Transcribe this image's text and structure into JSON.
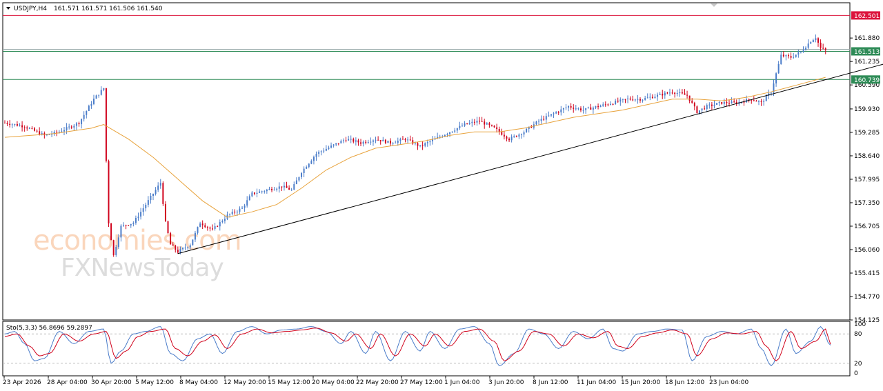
{
  "header": {
    "symbol": "USDJPY,H4",
    "ohlc": "161.571 161.571 161.506 161.540"
  },
  "watermark": {
    "line1": "economies.com",
    "line2": "FXNewsToday"
  },
  "chart_data": [
    {
      "type": "candlestick",
      "series_name": "USDJPY,H4",
      "ylim": [
        154.125,
        162.85
      ],
      "y_ticks": [
        "162.501",
        "161.880",
        "161.513",
        "161.235",
        "160.739",
        "160.590",
        "159.930",
        "159.285",
        "158.640",
        "157.995",
        "157.350",
        "156.705",
        "156.060",
        "155.415",
        "154.770",
        "154.125"
      ],
      "x_ticks": [
        "23 Apr 2026",
        "28 Apr 04:00",
        "30 Apr 20:00",
        "5 May 12:00",
        "8 May 04:00",
        "12 May 20:00",
        "15 May 12:00",
        "20 May 04:00",
        "22 May 20:00",
        "27 May 12:00",
        "1 Jun 04:00",
        "3 Jun 20:00",
        "8 Jun 12:00",
        "11 Jun 04:00",
        "15 Jun 20:00",
        "18 Jun 12:00",
        "23 Jun 04:00"
      ],
      "close_path": [
        [
          0,
          159.55
        ],
        [
          8,
          159.45
        ],
        [
          16,
          159.2
        ],
        [
          22,
          159.3
        ],
        [
          30,
          159.55
        ],
        [
          36,
          160.2
        ],
        [
          40,
          160.5
        ],
        [
          41,
          158.5
        ],
        [
          42,
          156.8
        ],
        [
          44,
          155.9
        ],
        [
          47,
          156.7
        ],
        [
          52,
          156.8
        ],
        [
          57,
          157.3
        ],
        [
          61,
          157.7
        ],
        [
          63,
          157.9
        ],
        [
          65,
          156.8
        ],
        [
          67,
          156.2
        ],
        [
          70,
          156.0
        ],
        [
          75,
          156.2
        ],
        [
          79,
          156.8
        ],
        [
          84,
          156.6
        ],
        [
          90,
          157.0
        ],
        [
          96,
          157.2
        ],
        [
          100,
          157.6
        ],
        [
          106,
          157.7
        ],
        [
          112,
          157.8
        ],
        [
          116,
          157.7
        ],
        [
          120,
          158.2
        ],
        [
          126,
          158.7
        ],
        [
          132,
          158.9
        ],
        [
          138,
          159.1
        ],
        [
          144,
          159.0
        ],
        [
          150,
          159.1
        ],
        [
          156,
          159.0
        ],
        [
          162,
          159.1
        ],
        [
          168,
          158.9
        ],
        [
          174,
          159.1
        ],
        [
          180,
          159.3
        ],
        [
          186,
          159.5
        ],
        [
          192,
          159.6
        ],
        [
          198,
          159.4
        ],
        [
          204,
          159.1
        ],
        [
          210,
          159.3
        ],
        [
          216,
          159.6
        ],
        [
          222,
          159.8
        ],
        [
          228,
          160.0
        ],
        [
          234,
          159.9
        ],
        [
          240,
          160.0
        ],
        [
          246,
          160.1
        ],
        [
          252,
          160.2
        ],
        [
          258,
          160.2
        ],
        [
          264,
          160.3
        ],
        [
          270,
          160.4
        ],
        [
          276,
          160.3
        ],
        [
          280,
          159.85
        ],
        [
          284,
          160.0
        ],
        [
          290,
          160.1
        ],
        [
          296,
          160.1
        ],
        [
          302,
          160.2
        ],
        [
          306,
          160.1
        ],
        [
          310,
          160.4
        ],
        [
          312,
          160.9
        ],
        [
          314,
          161.4
        ],
        [
          318,
          161.35
        ],
        [
          322,
          161.5
        ],
        [
          326,
          161.8
        ],
        [
          328,
          161.9
        ],
        [
          330,
          161.6
        ],
        [
          332,
          161.54
        ]
      ],
      "ma_path": [
        [
          0,
          159.15
        ],
        [
          20,
          159.25
        ],
        [
          35,
          159.4
        ],
        [
          40,
          159.5
        ],
        [
          50,
          159.1
        ],
        [
          60,
          158.6
        ],
        [
          70,
          158.0
        ],
        [
          80,
          157.4
        ],
        [
          90,
          156.95
        ],
        [
          100,
          157.1
        ],
        [
          110,
          157.3
        ],
        [
          120,
          157.75
        ],
        [
          130,
          158.25
        ],
        [
          140,
          158.6
        ],
        [
          150,
          158.85
        ],
        [
          160,
          158.95
        ],
        [
          170,
          159.05
        ],
        [
          180,
          159.2
        ],
        [
          190,
          159.3
        ],
        [
          200,
          159.3
        ],
        [
          210,
          159.4
        ],
        [
          220,
          159.55
        ],
        [
          230,
          159.7
        ],
        [
          240,
          159.8
        ],
        [
          250,
          159.9
        ],
        [
          260,
          160.05
        ],
        [
          270,
          160.2
        ],
        [
          280,
          160.2
        ],
        [
          290,
          160.15
        ],
        [
          300,
          160.25
        ],
        [
          310,
          160.4
        ],
        [
          320,
          160.58
        ],
        [
          332,
          160.8
        ]
      ],
      "candles_per_period": 341,
      "trendline": [
        [
          70,
          155.95
        ],
        [
          363,
          161.3
        ]
      ],
      "levels": [
        {
          "value": 162.501,
          "label": "162.501",
          "color": "#dc143c"
        },
        {
          "value": 161.513,
          "label": "161.513",
          "color": "#2e8b57"
        },
        {
          "value": 160.739,
          "label": "160.739",
          "color": "#2e8b57"
        }
      ],
      "colors": {
        "up": "#4a7cc9",
        "down": "#d0021b",
        "ma": "#e8a33d",
        "trendline": "#000000"
      }
    },
    {
      "type": "line",
      "title": "Sto(5,3,3) 56.8696 59.2897",
      "ylim": [
        0,
        100
      ],
      "y_ticks": [
        "100",
        "80",
        "20",
        "0"
      ],
      "levels": [
        80,
        20
      ],
      "series": [
        {
          "name": "main",
          "color": "#4a7cc9"
        },
        {
          "name": "signal",
          "color": "#d0021b"
        }
      ],
      "main_path": [
        [
          0,
          80
        ],
        [
          4,
          85
        ],
        [
          8,
          60
        ],
        [
          12,
          25
        ],
        [
          16,
          30
        ],
        [
          22,
          85
        ],
        [
          28,
          60
        ],
        [
          34,
          85
        ],
        [
          40,
          90
        ],
        [
          43,
          20
        ],
        [
          47,
          45
        ],
        [
          52,
          80
        ],
        [
          57,
          85
        ],
        [
          63,
          95
        ],
        [
          67,
          40
        ],
        [
          72,
          25
        ],
        [
          78,
          70
        ],
        [
          83,
          80
        ],
        [
          88,
          40
        ],
        [
          94,
          85
        ],
        [
          100,
          95
        ],
        [
          106,
          80
        ],
        [
          112,
          88
        ],
        [
          118,
          90
        ],
        [
          124,
          95
        ],
        [
          130,
          85
        ],
        [
          136,
          60
        ],
        [
          140,
          85
        ],
        [
          146,
          40
        ],
        [
          150,
          85
        ],
        [
          156,
          25
        ],
        [
          162,
          85
        ],
        [
          168,
          45
        ],
        [
          172,
          85
        ],
        [
          178,
          50
        ],
        [
          184,
          90
        ],
        [
          190,
          95
        ],
        [
          196,
          60
        ],
        [
          200,
          15
        ],
        [
          206,
          40
        ],
        [
          212,
          90
        ],
        [
          218,
          80
        ],
        [
          224,
          50
        ],
        [
          230,
          85
        ],
        [
          236,
          70
        ],
        [
          242,
          90
        ],
        [
          246,
          50
        ],
        [
          250,
          45
        ],
        [
          256,
          80
        ],
        [
          262,
          85
        ],
        [
          268,
          90
        ],
        [
          274,
          88
        ],
        [
          278,
          25
        ],
        [
          284,
          75
        ],
        [
          290,
          85
        ],
        [
          296,
          80
        ],
        [
          302,
          90
        ],
        [
          306,
          50
        ],
        [
          310,
          15
        ],
        [
          316,
          90
        ],
        [
          320,
          40
        ],
        [
          326,
          65
        ],
        [
          330,
          95
        ],
        [
          334,
          57
        ]
      ],
      "signal_path": [
        [
          0,
          75
        ],
        [
          5,
          80
        ],
        [
          10,
          55
        ],
        [
          14,
          35
        ],
        [
          18,
          40
        ],
        [
          24,
          80
        ],
        [
          30,
          65
        ],
        [
          36,
          80
        ],
        [
          41,
          85
        ],
        [
          45,
          30
        ],
        [
          49,
          45
        ],
        [
          54,
          75
        ],
        [
          59,
          85
        ],
        [
          65,
          90
        ],
        [
          69,
          50
        ],
        [
          74,
          35
        ],
        [
          80,
          65
        ],
        [
          85,
          78
        ],
        [
          90,
          50
        ],
        [
          96,
          80
        ],
        [
          102,
          90
        ],
        [
          108,
          82
        ],
        [
          114,
          85
        ],
        [
          120,
          88
        ],
        [
          126,
          92
        ],
        [
          132,
          82
        ],
        [
          138,
          65
        ],
        [
          142,
          80
        ],
        [
          148,
          50
        ],
        [
          152,
          80
        ],
        [
          158,
          35
        ],
        [
          164,
          80
        ],
        [
          170,
          55
        ],
        [
          174,
          80
        ],
        [
          180,
          55
        ],
        [
          186,
          85
        ],
        [
          192,
          90
        ],
        [
          198,
          65
        ],
        [
          202,
          25
        ],
        [
          208,
          45
        ],
        [
          214,
          85
        ],
        [
          220,
          80
        ],
        [
          226,
          55
        ],
        [
          232,
          80
        ],
        [
          238,
          72
        ],
        [
          244,
          85
        ],
        [
          248,
          55
        ],
        [
          252,
          50
        ],
        [
          258,
          75
        ],
        [
          264,
          82
        ],
        [
          270,
          88
        ],
        [
          276,
          80
        ],
        [
          280,
          35
        ],
        [
          286,
          70
        ],
        [
          292,
          82
        ],
        [
          298,
          80
        ],
        [
          304,
          85
        ],
        [
          308,
          55
        ],
        [
          312,
          25
        ],
        [
          318,
          85
        ],
        [
          322,
          50
        ],
        [
          328,
          65
        ],
        [
          332,
          90
        ],
        [
          334,
          59
        ]
      ]
    }
  ]
}
